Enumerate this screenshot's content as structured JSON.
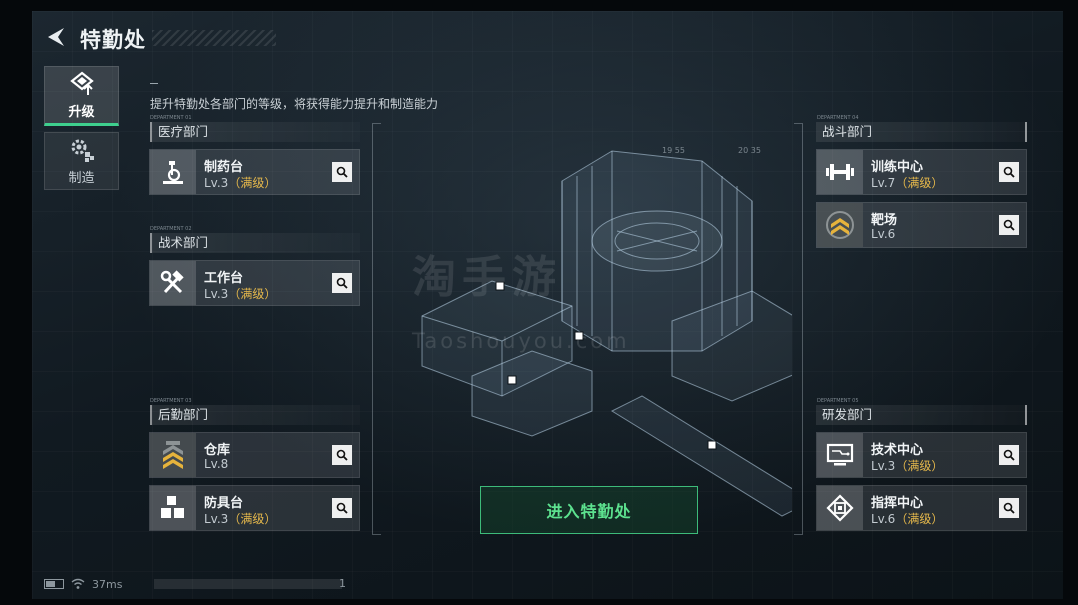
{
  "header": {
    "title": "特勤处"
  },
  "tabs": [
    {
      "label": "升级",
      "icon": "upgrade-icon",
      "active": true
    },
    {
      "label": "制造",
      "icon": "manufacture-gear-icon",
      "active": false
    }
  ],
  "subtitle": "提升特勤处各部门的等级，将获得能力提升和制造能力",
  "departments": {
    "medical": {
      "title": "医疗部门",
      "code": "DEPARTMENT 01",
      "facilities": [
        {
          "name": "制药台",
          "level": "Lv.3",
          "max": "（满级）",
          "icon": "microscope-icon"
        }
      ]
    },
    "tactical": {
      "title": "战术部门",
      "code": "DEPARTMENT 02",
      "facilities": [
        {
          "name": "工作台",
          "level": "Lv.3",
          "max": "（满级）",
          "icon": "hammer-wrench-icon"
        }
      ]
    },
    "logistics": {
      "title": "后勤部门",
      "code": "DEPARTMENT 03",
      "facilities": [
        {
          "name": "仓库",
          "level": "Lv.8",
          "max": "",
          "icon": "chevron-rank-icon"
        },
        {
          "name": "防具台",
          "level": "Lv.3",
          "max": "（满级）",
          "icon": "cubes-icon"
        }
      ]
    },
    "combat": {
      "title": "战斗部门",
      "code": "DEPARTMENT 04",
      "facilities": [
        {
          "name": "训练中心",
          "level": "Lv.7",
          "max": "（满级）",
          "icon": "dumbbell-icon"
        },
        {
          "name": "靶场",
          "level": "Lv.6",
          "max": "",
          "icon": "target-chevron-icon"
        }
      ]
    },
    "research": {
      "title": "研发部门",
      "code": "DEPARTMENT 05",
      "facilities": [
        {
          "name": "技术中心",
          "level": "Lv.3",
          "max": "（满级）",
          "icon": "monitor-circuit-icon"
        },
        {
          "name": "指挥中心",
          "level": "Lv.6",
          "max": "（满级）",
          "icon": "chip-icon"
        }
      ]
    }
  },
  "enter_button": "进入特勤处",
  "watermark": {
    "line1": "淘手游",
    "line2": "Taoshouyou.com"
  },
  "hud_readout": {
    "left": "19 55",
    "right": "20 35"
  },
  "status": {
    "ping": "37ms",
    "page": "1"
  },
  "colors": {
    "accent_green": "#3ecf8e",
    "max_level": "#e5b84b"
  }
}
